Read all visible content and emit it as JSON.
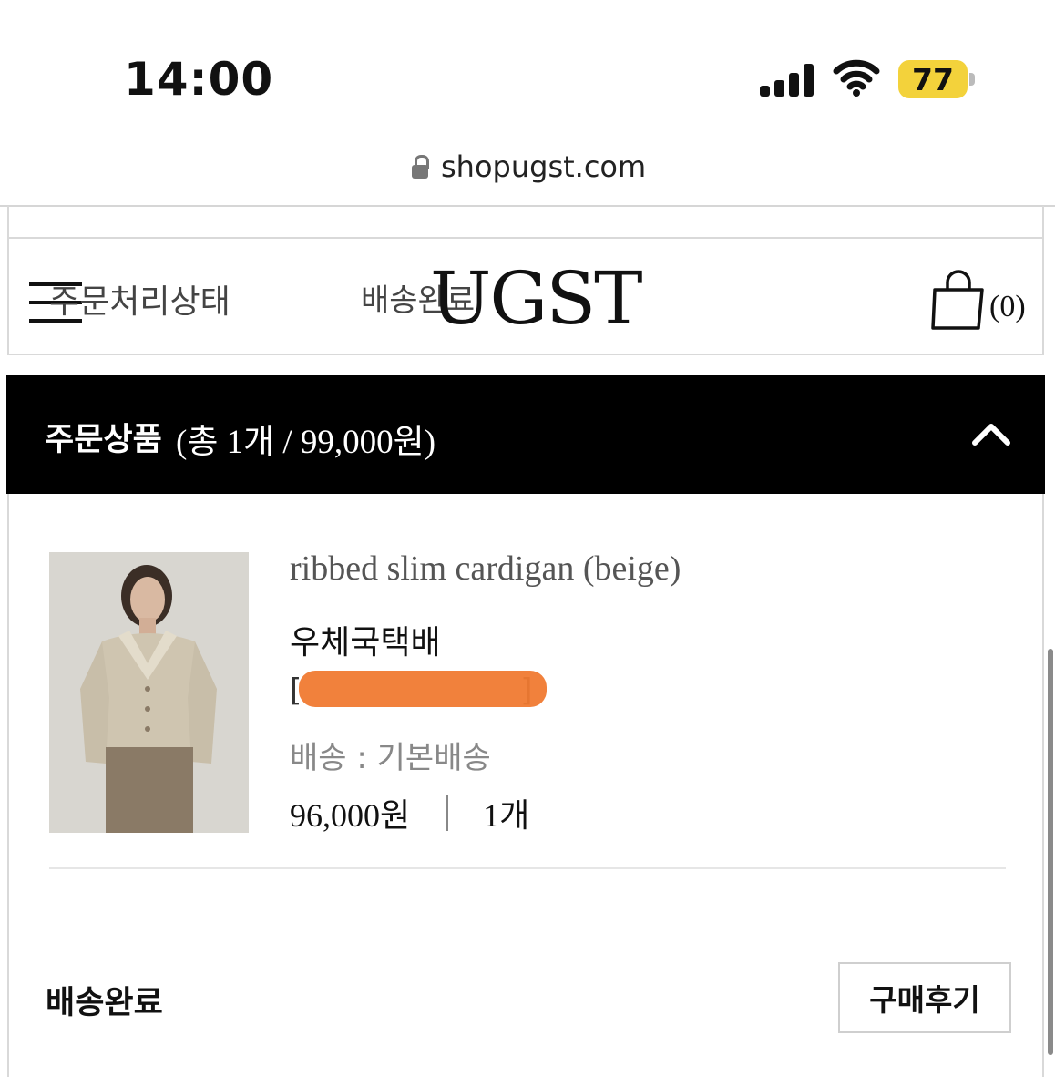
{
  "status_bar": {
    "time": "14:00",
    "battery": "77",
    "icons": [
      "signal-icon",
      "wifi-icon",
      "battery-icon"
    ],
    "battery_color": "#f3d23b"
  },
  "browser": {
    "url": "shopugst.com",
    "icon": "lock-icon"
  },
  "header": {
    "order_status_label": "주문처리상태",
    "delivered_label": "배송완료",
    "logo": "UGST",
    "cart_count": "(0)",
    "icons": [
      "hamburger-icon",
      "shopping-bag-icon"
    ]
  },
  "order_bar": {
    "title": "주문상품",
    "summary": "(총 1개 / 99,000원)",
    "icon": "chevron-up-icon",
    "background": "#000000"
  },
  "product": {
    "name": "ribbed slim cardigan (beige)",
    "courier": "우체국택배",
    "tracking_prefix": "[",
    "tracking_suffix": "]",
    "shipping": "배송 : 기본배송",
    "price": "96,000원",
    "quantity": "1개"
  },
  "footer": {
    "status": "배송완료",
    "review_button": "구매후기"
  }
}
